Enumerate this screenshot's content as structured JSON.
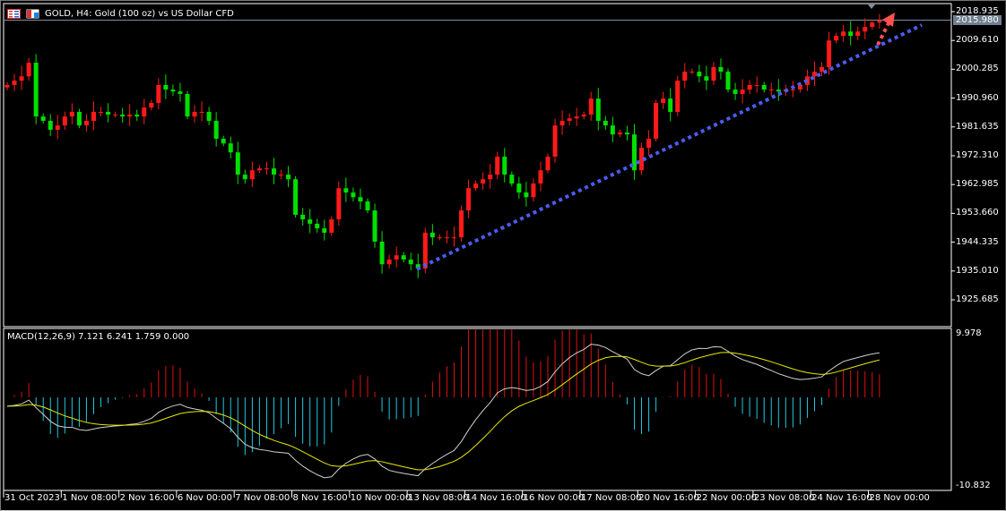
{
  "header": {
    "title": "GOLD, H4:  Gold (100 oz) vs US Dollar CFD",
    "icons": [
      "market-watch-icon",
      "chart-window-icon"
    ]
  },
  "price_axis": [
    "2018.935",
    "2009.610",
    "2000.285",
    "1990.960",
    "1981.635",
    "1972.310",
    "1962.985",
    "1953.660",
    "1944.335",
    "1935.010",
    "1925.685"
  ],
  "current_price": "2015.980",
  "macd": {
    "label": "MACD(12,26,9) 7.121 6.241 1.759 0.000",
    "axis_max": "9.978",
    "axis_min": "-10.832"
  },
  "time_axis": [
    "31 Oct 2023",
    "1 Nov 08:00",
    "2 Nov 16:00",
    "6 Nov 00:00",
    "7 Nov 08:00",
    "8 Nov 16:00",
    "10 Nov 00:00",
    "13 Nov 08:00",
    "14 Nov 16:00",
    "16 Nov 00:00",
    "17 Nov 08:00",
    "20 Nov 16:00",
    "22 Nov 00:00",
    "23 Nov 08:00",
    "24 Nov 16:00",
    "28 Nov 00:00"
  ],
  "colors": {
    "bull": "#ff1a1a",
    "bear": "#00e000",
    "trendline": "#4a5cf0",
    "arrow": "#ff5050",
    "macd_pos": "#e01010",
    "macd_neg": "#20c8e0",
    "signal": "#e8e800",
    "main": "#d0d0d0"
  },
  "chart_data": {
    "type": "candlestick",
    "symbol": "GOLD",
    "timeframe": "H4",
    "ylim": [
      1921,
      2021
    ],
    "closes": [
      1995.2,
      1996.6,
      1998.0,
      2002.4,
      1985.0,
      1983.6,
      1980.7,
      1982.1,
      1985.0,
      1986.5,
      1982.1,
      1983.6,
      1986.5,
      1986.5,
      1985.6,
      1985.6,
      1985.0,
      1985.6,
      1985.0,
      1987.9,
      1989.4,
      1995.2,
      1993.7,
      1993.1,
      1992.3,
      1985.0,
      1986.5,
      1986.5,
      1983.6,
      1977.8,
      1976.3,
      1973.4,
      1966.2,
      1964.7,
      1967.6,
      1968.2,
      1968.2,
      1966.2,
      1966.2,
      1964.7,
      1953.2,
      1951.7,
      1950.3,
      1948.8,
      1947.4,
      1951.7,
      1961.8,
      1960.4,
      1958.9,
      1957.5,
      1954.6,
      1944.5,
      1937.2,
      1938.7,
      1940.1,
      1938.7,
      1937.2,
      1935.8,
      1947.4,
      1945.9,
      1945.9,
      1945.9,
      1945.9,
      1954.6,
      1961.8,
      1963.3,
      1964.7,
      1966.2,
      1972.0,
      1966.2,
      1963.3,
      1960.4,
      1958.9,
      1963.3,
      1967.6,
      1972.0,
      1982.1,
      1983.6,
      1984.4,
      1985.0,
      1985.6,
      1990.8,
      1983.6,
      1982.1,
      1979.2,
      1979.8,
      1979.2,
      1967.6,
      1974.9,
      1977.8,
      1989.4,
      1990.8,
      1986.5,
      1996.6,
      1999.5,
      1999.5,
      1998.0,
      1996.6,
      2001.0,
      1999.5,
      1993.7,
      1992.3,
      1993.7,
      1995.2,
      1995.2,
      1993.7,
      1993.7,
      1993.1,
      1993.7,
      1993.7,
      1995.2,
      1998.0,
      1999.5,
      2001.0,
      2009.6,
      2011.1,
      2012.5,
      2011.1,
      2012.5,
      2014.0,
      2015.4,
      2015.98
    ],
    "trendline": {
      "from_price": 1935.0,
      "to_price": 2016.0
    }
  }
}
